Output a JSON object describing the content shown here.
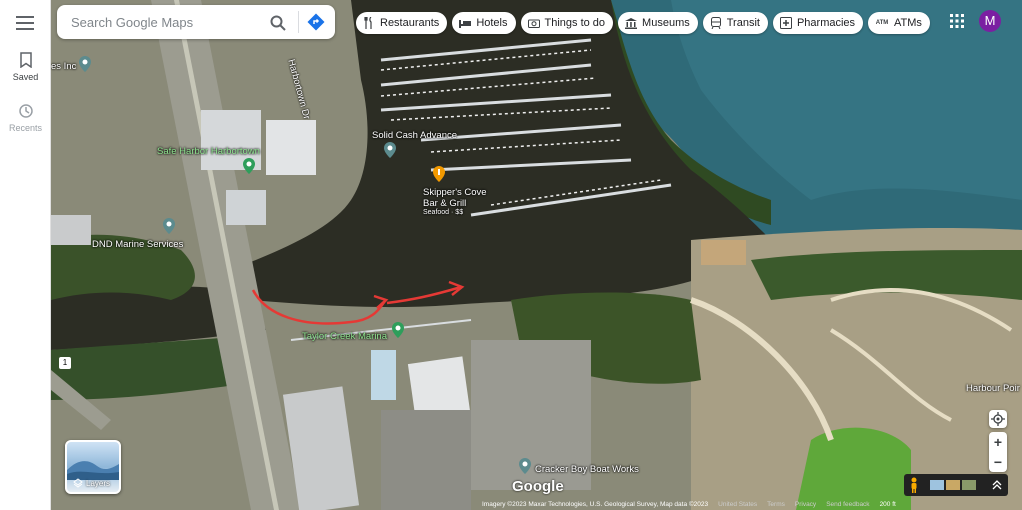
{
  "search": {
    "placeholder": "Search Google Maps"
  },
  "rail": {
    "saved_label": "Saved",
    "recents_label": "Recents"
  },
  "chips": [
    {
      "label": "Restaurants",
      "icon": "fork-knife-icon"
    },
    {
      "label": "Hotels",
      "icon": "bed-icon"
    },
    {
      "label": "Things to do",
      "icon": "camera-icon"
    },
    {
      "label": "Museums",
      "icon": "museum-icon"
    },
    {
      "label": "Transit",
      "icon": "train-icon"
    },
    {
      "label": "Pharmacies",
      "icon": "pharmacy-icon"
    },
    {
      "label": "ATMs",
      "icon": "atm-icon",
      "icon_text": "ATM"
    }
  ],
  "account": {
    "initial": "M",
    "color": "#7b1fa2"
  },
  "map_labels": {
    "harbortown_dr": "Harbortown Dr",
    "solid_cash": "Solid Cash Advance",
    "safe_harbor": "Safe Harbor Harbortown",
    "skippers_line1": "Skipper's Cove",
    "skippers_line2": "Bar & Grill",
    "skippers_sub": "Seafood · $$",
    "dnd_marine": "DND Marine Services",
    "taylor_creek": "Taylor Creek Marina",
    "cracker_boy": "Cracker Boy Boat Works",
    "harbour_point": "Harbour Poir",
    "inc": "es Inc",
    "route_1": "1"
  },
  "layers": {
    "label": "Layers"
  },
  "zoom": {
    "in": "+",
    "out": "−"
  },
  "footer": {
    "imagery": "Imagery ©2023 Maxar Technologies, U.S. Geological Survey, Map data ©2023",
    "country": "United States",
    "terms": "Terms",
    "privacy": "Privacy",
    "feedback": "Send feedback",
    "scale": "200 ft"
  },
  "logo": "Google",
  "colors": {
    "arrow": "#e53935",
    "water": "#2c2d24",
    "bay": "#2f6a78"
  }
}
